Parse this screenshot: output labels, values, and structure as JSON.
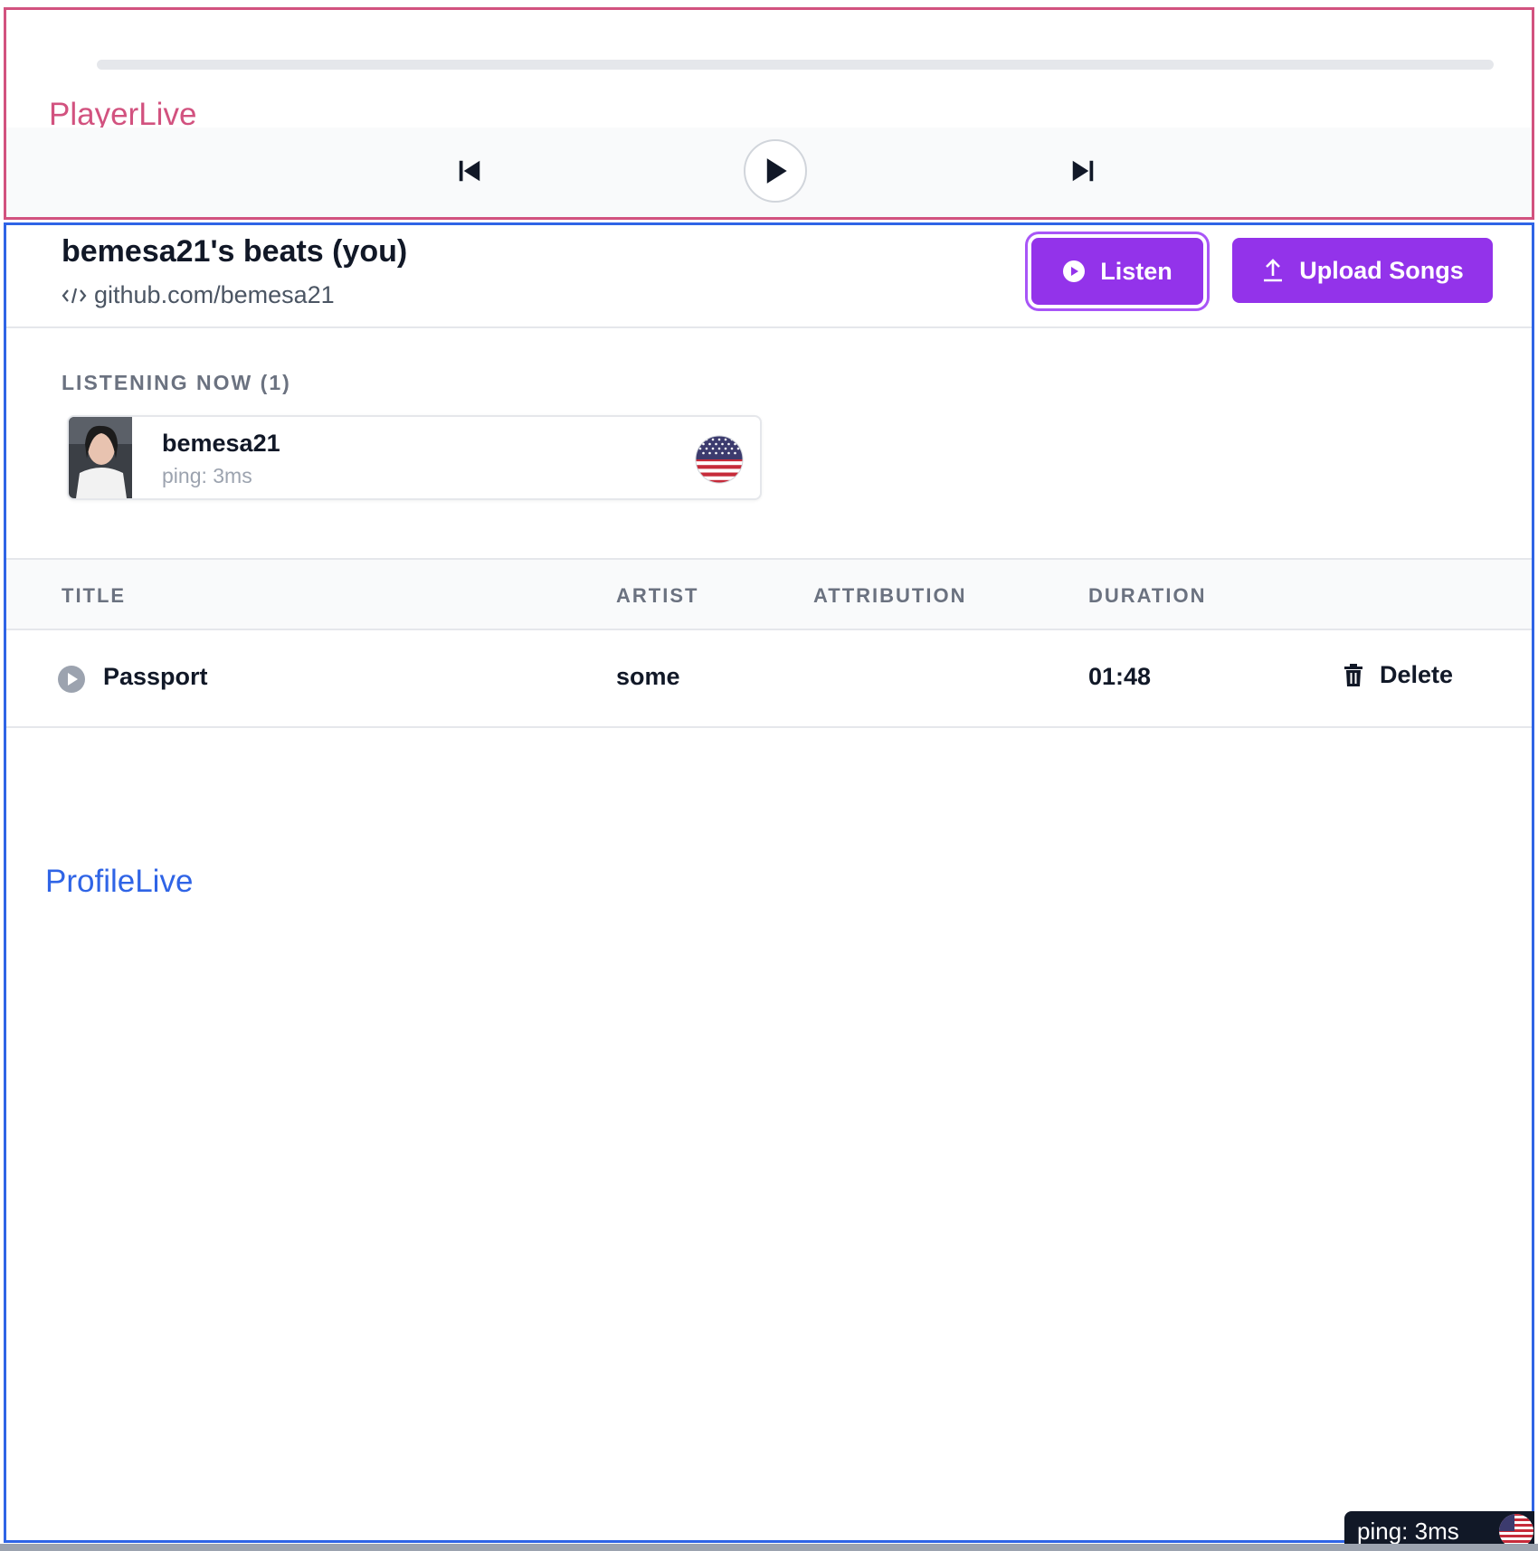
{
  "player": {
    "label": "PlayerLive",
    "progress_percent": 0,
    "accent_color": "#d2527f",
    "controls": [
      {
        "name": "previous",
        "icon": "skip-back-icon"
      },
      {
        "name": "play",
        "icon": "play-icon"
      },
      {
        "name": "next",
        "icon": "skip-forward-icon"
      }
    ]
  },
  "profile": {
    "label": "ProfileLive",
    "accent_color": "#2f64e6",
    "title": "bemesa21's beats (you)",
    "link_text": "github.com/bemesa21",
    "link_icon": "code-icon",
    "buttons": {
      "listen": {
        "label": "Listen",
        "icon": "play-circle-icon"
      },
      "upload": {
        "label": "Upload Songs",
        "icon": "upload-icon"
      }
    },
    "brand_color": "#9333ea"
  },
  "listening": {
    "heading": "LISTENING NOW (1)",
    "listeners": [
      {
        "name": "bemesa21",
        "ping": "ping: 3ms",
        "flag": "us-flag-icon",
        "avatar": "avatar"
      }
    ]
  },
  "songs_table": {
    "columns": [
      "TITLE",
      "ARTIST",
      "ATTRIBUTION",
      "DURATION"
    ],
    "rows": [
      {
        "title": "Passport",
        "artist": "some",
        "attribution": "",
        "duration": "01:48",
        "action": "Delete"
      }
    ]
  },
  "ping_widget": {
    "text": "ping: 3ms",
    "flag": "us-flag-icon"
  }
}
